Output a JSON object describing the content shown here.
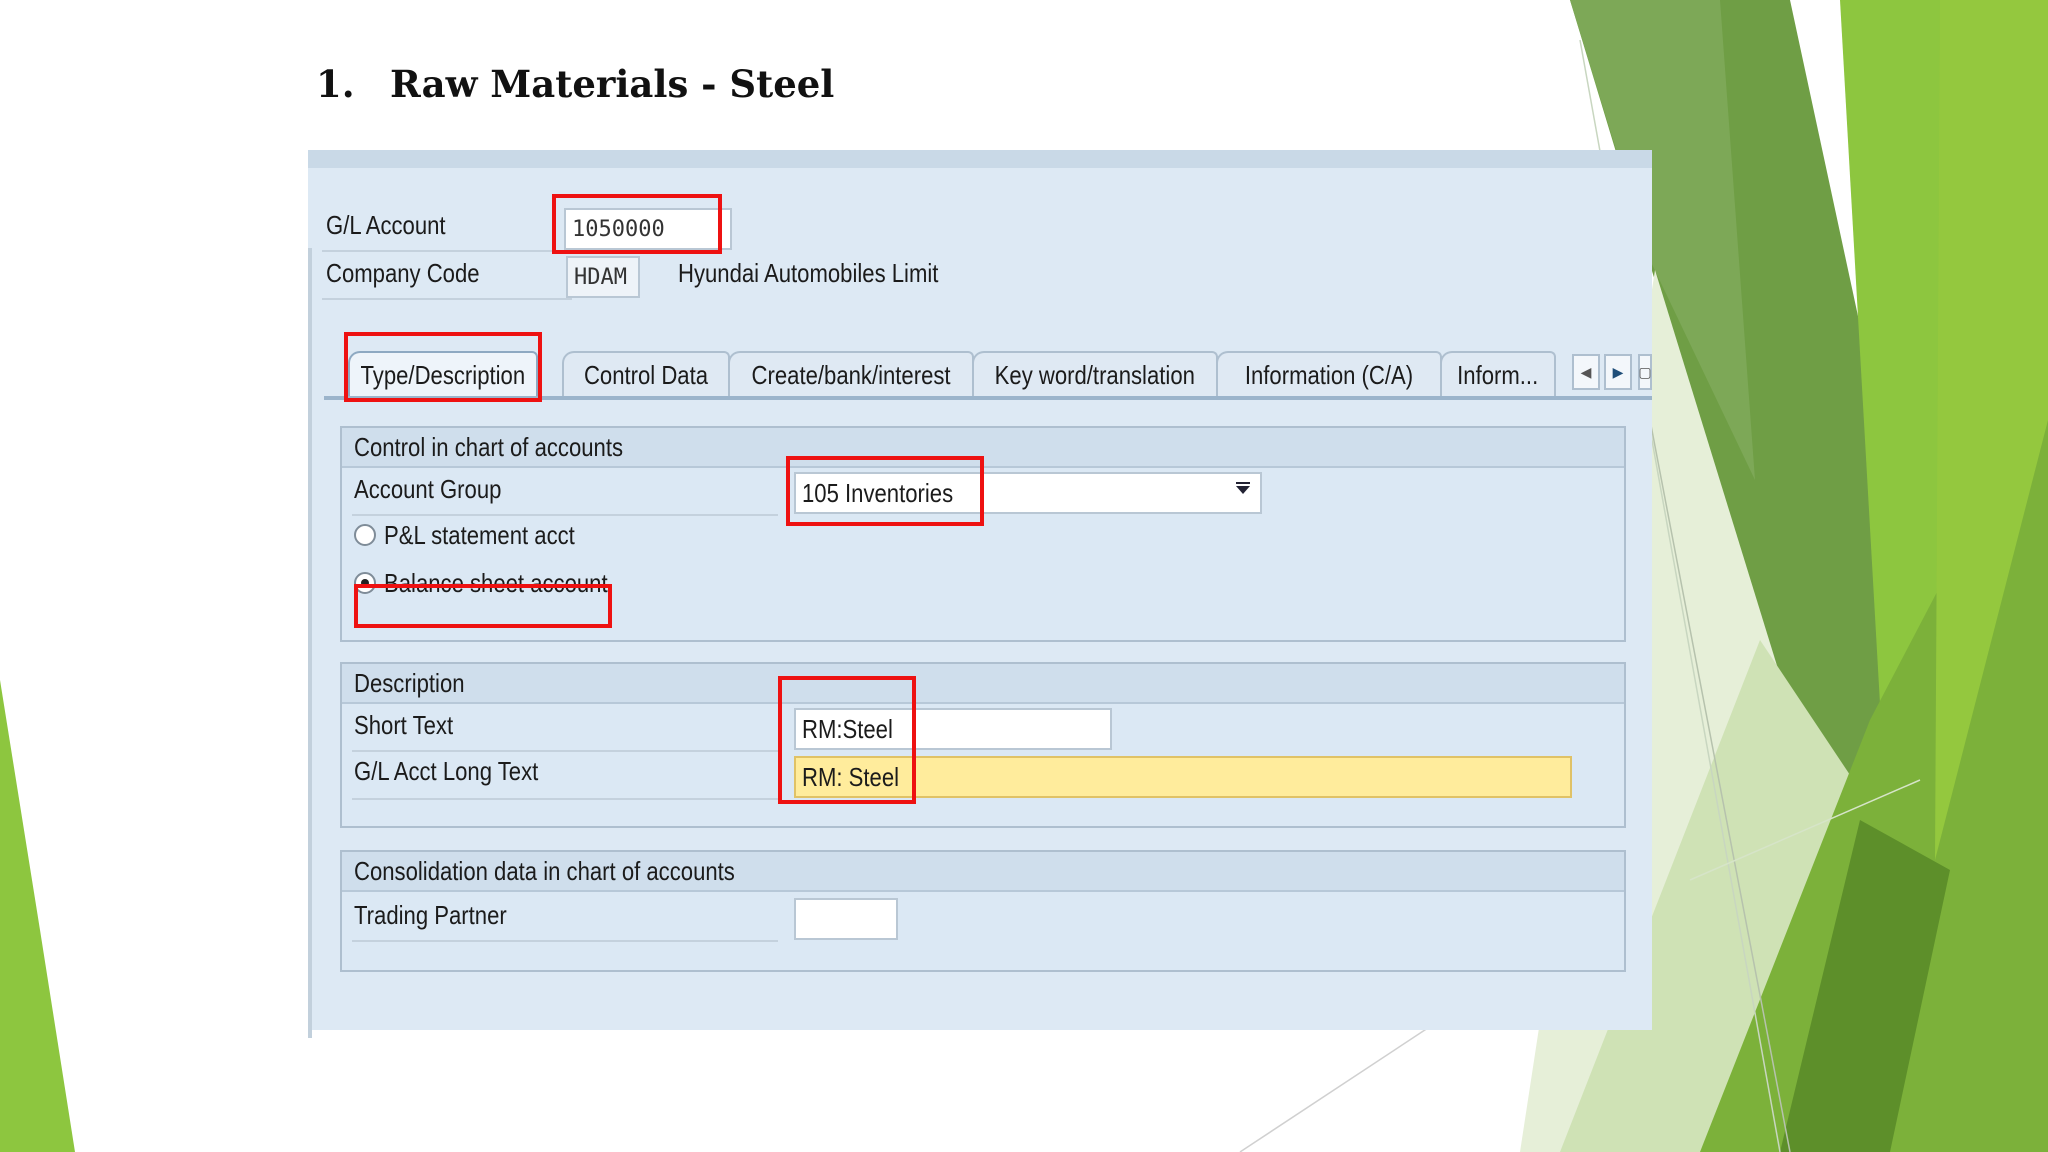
{
  "slide": {
    "number": "1.",
    "title": "Raw Materials - Steel"
  },
  "header": {
    "gl_account_label": "G/L Account",
    "gl_account_value": "1050000",
    "company_code_label": "Company Code",
    "company_code_value": "HDAM",
    "company_name": "Hyundai Automobiles Limit"
  },
  "tabs": [
    {
      "label": "Type/Description",
      "active": true
    },
    {
      "label": "Control Data"
    },
    {
      "label": "Create/bank/interest"
    },
    {
      "label": "Key word/translation"
    },
    {
      "label": "Information (C/A)"
    },
    {
      "label": "Inform..."
    }
  ],
  "control_group": {
    "title": "Control in chart of accounts",
    "account_group_label": "Account Group",
    "account_group_value": "105 Inventories",
    "pl_label": "P&L statement acct",
    "bs_label": "Balance sheet account",
    "selected": "Balance sheet account"
  },
  "description_group": {
    "title": "Description",
    "short_text_label": "Short Text",
    "short_text_value": "RM:Steel",
    "long_text_label": "G/L Acct Long Text",
    "long_text_value": "RM: Steel"
  },
  "consolidation_group": {
    "title": "Consolidation data in chart of accounts",
    "trading_partner_label": "Trading Partner",
    "trading_partner_value": ""
  },
  "colors": {
    "highlight": "#ee1111",
    "green_dark": "#5f9a3a",
    "green_light": "#8dc63f",
    "active_field": "#ffec9c"
  }
}
